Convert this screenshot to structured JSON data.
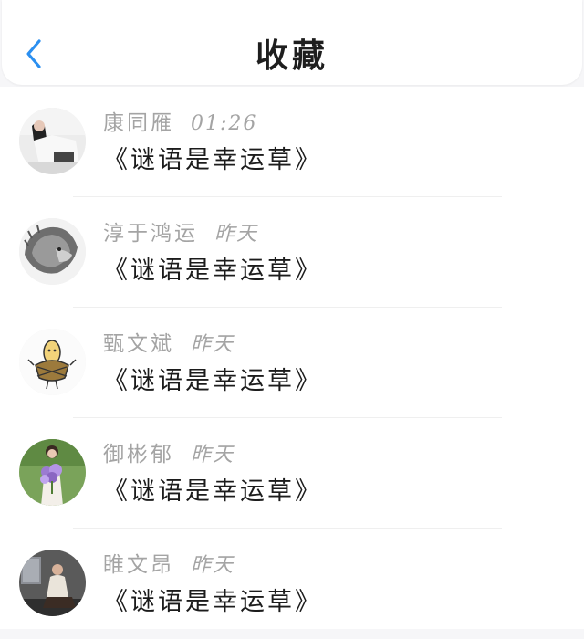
{
  "header": {
    "title": "收藏",
    "back_icon": "chevron-left-icon",
    "accent_color": "#2b8ff0"
  },
  "favorites": [
    {
      "user": "康同雁",
      "time": "01:26",
      "title": "《谜语是幸运草》",
      "avatar": "avatar-woman-in-studio"
    },
    {
      "user": "淳于鸿运",
      "time": "昨天",
      "title": "《谜语是幸运草》",
      "avatar": "avatar-lion-sketch"
    },
    {
      "user": "甄文斌",
      "time": "昨天",
      "title": "《谜语是幸运草》",
      "avatar": "avatar-corn-cartoon"
    },
    {
      "user": "御彬郁",
      "time": "昨天",
      "title": "《谜语是幸运草》",
      "avatar": "avatar-woman-with-flowers"
    },
    {
      "user": "睢文昂",
      "time": "昨天",
      "title": "《谜语是幸运草》",
      "avatar": "avatar-man-indoors"
    }
  ]
}
